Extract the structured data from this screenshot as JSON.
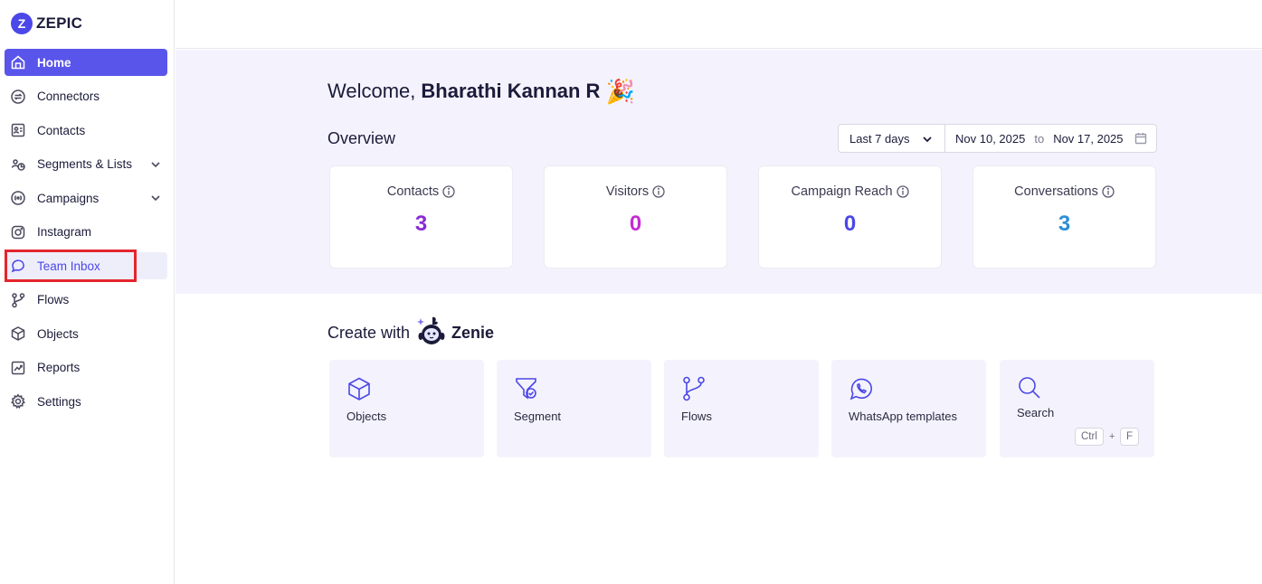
{
  "brand": {
    "name": "ZEPIC",
    "mark": "Z"
  },
  "sidebar": {
    "items": [
      {
        "label": "Home",
        "icon": "home-icon"
      },
      {
        "label": "Connectors",
        "icon": "connectors-icon"
      },
      {
        "label": "Contacts",
        "icon": "contacts-icon"
      },
      {
        "label": "Segments & Lists",
        "icon": "segments-icon"
      },
      {
        "label": "Campaigns",
        "icon": "campaigns-icon"
      },
      {
        "label": "Instagram",
        "icon": "instagram-icon"
      },
      {
        "label": "Team Inbox",
        "icon": "inbox-icon"
      },
      {
        "label": "Flows",
        "icon": "flows-icon"
      },
      {
        "label": "Objects",
        "icon": "objects-icon"
      },
      {
        "label": "Reports",
        "icon": "reports-icon"
      },
      {
        "label": "Settings",
        "icon": "settings-icon"
      }
    ]
  },
  "welcome": {
    "prefix": "Welcome,",
    "name": "Bharathi Kannan R",
    "emoji": "🎉"
  },
  "overview": {
    "title": "Overview",
    "range": "Last 7 days",
    "from": "Nov 10, 2025",
    "to_label": "to",
    "to": "Nov 17, 2025",
    "stats": [
      {
        "label": "Contacts",
        "value": "3",
        "color": "#8a2bd6"
      },
      {
        "label": "Visitors",
        "value": "0",
        "color": "#c42cd3"
      },
      {
        "label": "Campaign Reach",
        "value": "0",
        "color": "#4b47e8"
      },
      {
        "label": "Conversations",
        "value": "3",
        "color": "#2a8fd8"
      }
    ]
  },
  "create": {
    "prefix": "Create with",
    "brand": "Zenie",
    "tiles": [
      {
        "label": "Objects",
        "icon": "cube-icon"
      },
      {
        "label": "Segment",
        "icon": "segment-filter-icon"
      },
      {
        "label": "Flows",
        "icon": "flows-icon"
      },
      {
        "label": "WhatsApp templates",
        "icon": "whatsapp-icon"
      },
      {
        "label": "Search",
        "icon": "search-icon",
        "shortcut": [
          "Ctrl",
          "F"
        ],
        "shortcut_joiner": "+"
      }
    ]
  },
  "colors": {
    "accent": "#5a55ea",
    "highlight": "#e4252c",
    "band": "#f4f3fd"
  }
}
